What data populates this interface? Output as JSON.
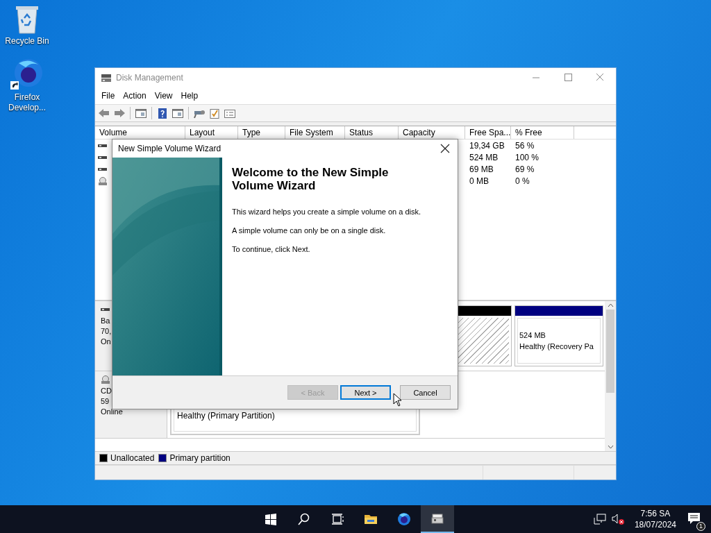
{
  "desktop_icons": [
    {
      "kind": "recycle",
      "label": "Recycle Bin"
    },
    {
      "kind": "firefox",
      "label": "Firefox Develop..."
    }
  ],
  "window": {
    "title": "Disk Management",
    "menu": [
      "File",
      "Action",
      "View",
      "Help"
    ],
    "toolbar": [
      {
        "kind": "back"
      },
      {
        "kind": "forward"
      },
      {
        "kind": "sep"
      },
      {
        "kind": "panel"
      },
      {
        "kind": "sep"
      },
      {
        "kind": "help"
      },
      {
        "kind": "panel"
      },
      {
        "kind": "sep"
      },
      {
        "kind": "key"
      },
      {
        "kind": "check"
      },
      {
        "kind": "list"
      }
    ],
    "volume_table": {
      "columns": [
        "Volume",
        "Layout",
        "Type",
        "File System",
        "Status",
        "Capacity",
        "Free Spa...",
        "% Free"
      ],
      "rows": [
        {
          "kind": "disk",
          "free_space": "19,34 GB",
          "percent_free": "56 %"
        },
        {
          "kind": "disk",
          "free_space": "524 MB",
          "percent_free": "100 %"
        },
        {
          "kind": "disk",
          "free_space": "69 MB",
          "percent_free": "69 %"
        },
        {
          "kind": "cd",
          "free_space": "0 MB",
          "percent_free": "0 %"
        }
      ]
    },
    "disks": [
      {
        "kind": "disk",
        "label_lines": [
          "Ba",
          "70,",
          "On"
        ],
        "partitions": [
          {
            "kind": "unallocated"
          },
          {
            "kind": "primary",
            "lines": [
              "524 MB",
              "Healthy (Recovery Pa"
            ]
          }
        ]
      },
      {
        "kind": "cd",
        "label_lines": [
          "CD",
          "59",
          "Online"
        ],
        "partitions": [
          {
            "kind": "primary_open",
            "lines": [
              "Healthy (Primary Partition)"
            ]
          }
        ]
      }
    ],
    "legend": [
      {
        "label": "Unallocated",
        "color": "#000000"
      },
      {
        "label": "Primary partition",
        "color": "#000080"
      }
    ]
  },
  "dialog": {
    "title": "New Simple Volume Wizard",
    "heading": "Welcome to the New Simple Volume Wizard",
    "paragraphs": [
      "This wizard helps you create a simple volume on a disk.",
      "A simple volume can only be on a single disk.",
      "To continue, click Next."
    ],
    "buttons": [
      {
        "label": "< Back",
        "disabled": true,
        "default": false
      },
      {
        "label": "Next >",
        "disabled": false,
        "default": true
      },
      {
        "label": "Cancel",
        "disabled": false,
        "default": false
      }
    ]
  },
  "taskbar": {
    "apps": [
      {
        "kind": "start",
        "selected": false
      },
      {
        "kind": "search",
        "selected": false
      },
      {
        "kind": "taskview",
        "selected": false
      },
      {
        "kind": "explorer",
        "selected": false
      },
      {
        "kind": "firefox",
        "selected": false
      },
      {
        "kind": "disk",
        "selected": true
      }
    ],
    "time": "7:56 SA",
    "date": "18/07/2024",
    "notification_count": "1"
  }
}
